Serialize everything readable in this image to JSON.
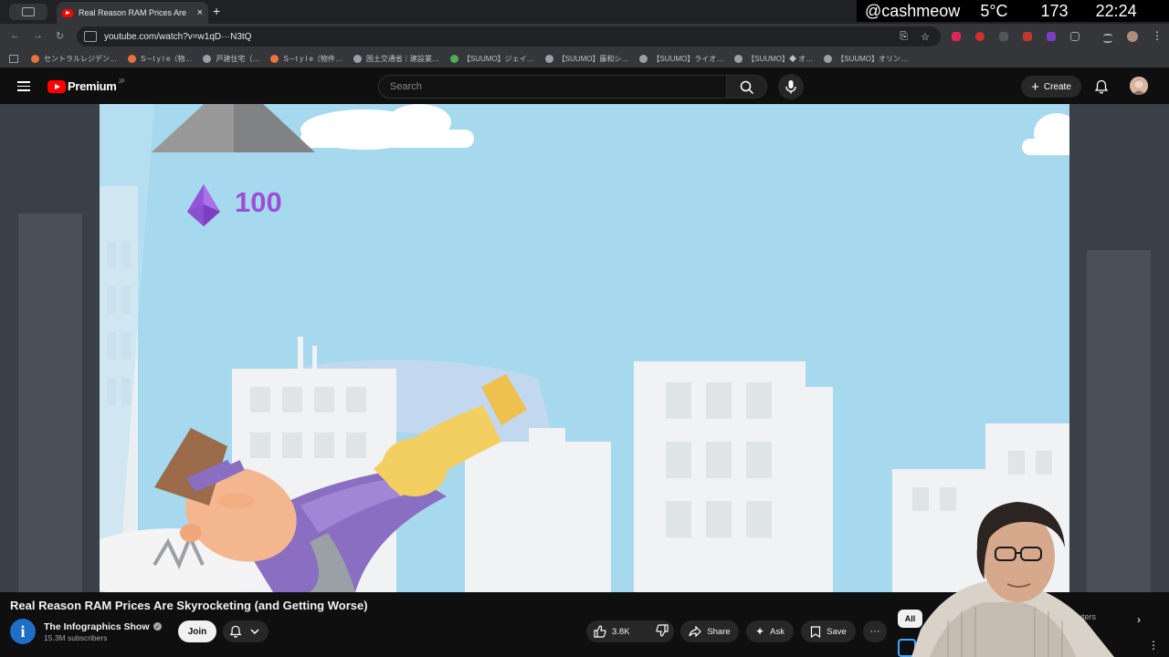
{
  "browser": {
    "tab_title": "Real Reason RAM Prices Are",
    "tab_close": "×",
    "new_tab": "+",
    "url": "youtube.com/watch?v=w1qD···N3tQ",
    "bookmarks": [
      {
        "label": "セントラルレジデン…",
        "color": "#e8743b"
      },
      {
        "label": "S－t y l e（物…",
        "color": "#e8743b"
      },
      {
        "label": "戸建住宅（…",
        "color": "#9aa0a6"
      },
      {
        "label": "S－t y l e（物件…",
        "color": "#e8743b"
      },
      {
        "label": "国土交通省｜建設業…",
        "color": "#9aa0a6"
      },
      {
        "label": "【SUUMO】ジェイ…",
        "color": "#4caf50"
      },
      {
        "label": "【SUUMO】藤和シ…",
        "color": "#9aa0a6"
      },
      {
        "label": "【SUUMO】ライオ…",
        "color": "#9aa0a6"
      },
      {
        "label": "【SUUMO】◆ オ…",
        "color": "#9aa0a6"
      },
      {
        "label": "【SUUMO】オリン…",
        "color": "#9aa0a6"
      }
    ]
  },
  "system": {
    "handle": "@cashmeow",
    "temperature": "5°C",
    "number": "173",
    "time": "22:24"
  },
  "youtube": {
    "logo_text": "Premium",
    "logo_region": "JP",
    "search_placeholder": "Search",
    "create_label": "Create"
  },
  "video": {
    "overlay_value": "100",
    "title": "Real Reason RAM Prices Are Skyrocketing (and Getting Worse)"
  },
  "channel": {
    "initial": "i",
    "name": "The Infographics Show",
    "verified_mark": "✓",
    "subscribers": "15.3M subscribers",
    "join_label": "Join"
  },
  "actions": {
    "likes": "3.8K",
    "share": "Share",
    "ask": "Ask",
    "save": "Save",
    "more": "···"
  },
  "chips": {
    "all": "All",
    "partial": "uters",
    "next": "›"
  },
  "colors": {
    "youtube_red": "#ff0000",
    "gem_purple": "#9c4fd6",
    "sky": "#a6d8ee",
    "page_bg": "#0f0f0f"
  }
}
